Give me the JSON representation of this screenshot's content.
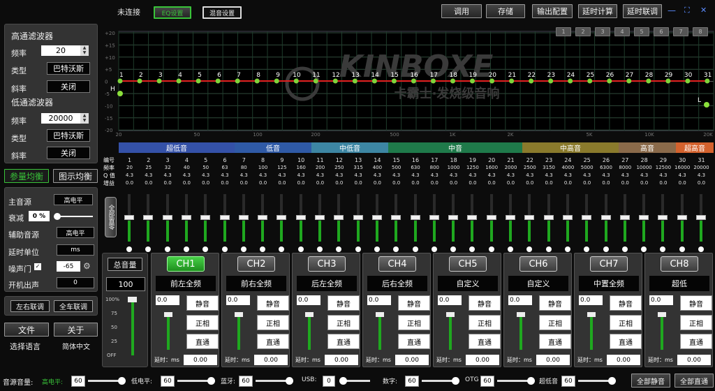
{
  "topbar": {
    "status": "未连接",
    "tab_eq": "EQ设置",
    "tab_mix": "混音设置",
    "buttons": [
      "调用",
      "存储",
      "输出配置",
      "延时计算",
      "延时联调"
    ],
    "win_min": "—",
    "win_max": "⛶",
    "win_close": "✕"
  },
  "presets": [
    "1",
    "2",
    "3",
    "4",
    "5",
    "6",
    "7",
    "8"
  ],
  "highpass": {
    "title": "高通滤波器",
    "freq_label": "频率",
    "freq": "20",
    "type_label": "类型",
    "type": "巴特沃斯",
    "slope_label": "斜率",
    "slope": "关闭"
  },
  "lowpass": {
    "title": "低通滤波器",
    "freq_label": "频率",
    "freq": "20000",
    "type_label": "类型",
    "type": "巴特沃斯",
    "slope_label": "斜率",
    "slope": "关闭"
  },
  "modes": {
    "param": "参量均衡",
    "graphic": "图示均衡"
  },
  "source": {
    "main_label": "主音源",
    "main": "高电平",
    "atten_label": "衰减",
    "atten": "0 %",
    "aux_label": "辅助音源",
    "aux": "高电平",
    "delay_unit_label": "延时单位",
    "delay_unit": "ms",
    "noise_label": "噪声门",
    "noise": "-65",
    "power_label": "开机出声",
    "power": "0"
  },
  "link": {
    "lr": "左右联调",
    "all": "全车联调"
  },
  "file": {
    "file": "文件",
    "about": "关于",
    "lang_label": "选择语言",
    "lang": "简体中文"
  },
  "graph": {
    "y_labels": [
      "+20",
      "+15",
      "+10",
      "+5",
      "0",
      "-5",
      "-10",
      "-15",
      "-20"
    ],
    "x_labels": [
      "20",
      "50",
      "100",
      "200",
      "500",
      "1K",
      "2K",
      "5K",
      "10K",
      "20K"
    ],
    "watermark": "KINBOXE",
    "watermark_sub": "卡霸士·发烧级音响",
    "h_marker": "H",
    "l_marker": "L"
  },
  "bands": [
    {
      "name": "超低音",
      "color": "#3451a8"
    },
    {
      "name": "低音",
      "color": "#2f5aa6"
    },
    {
      "name": "中低音",
      "color": "#3d86a3"
    },
    {
      "name": "中音",
      "color": "#1f7a4a"
    },
    {
      "name": "中高音",
      "color": "#8a7a2c"
    },
    {
      "name": "高音",
      "color": "#8a6a4a"
    },
    {
      "name": "超高音",
      "color": "#d4622d"
    }
  ],
  "eq_headers": {
    "num": "编号",
    "freq": "频率",
    "q": "Q 值",
    "gain": "增益"
  },
  "eq_freqs": [
    "20",
    "25",
    "32",
    "40",
    "50",
    "63",
    "80",
    "100",
    "125",
    "160",
    "200",
    "250",
    "315",
    "400",
    "500",
    "630",
    "800",
    "1000",
    "1250",
    "1600",
    "2000",
    "2500",
    "3150",
    "4000",
    "5000",
    "6300",
    "8000",
    "10000",
    "12500",
    "16000",
    "20000"
  ],
  "eq_q": "4.3",
  "eq_gain": "0.0",
  "reset_all": "全部置零",
  "master": {
    "label": "总音量",
    "value": "100",
    "scale": [
      "100%",
      "75",
      "50",
      "25",
      "OFF"
    ]
  },
  "channels": [
    {
      "id": "CH1",
      "name": "前左全频",
      "db": "0.0",
      "delay": "0.00"
    },
    {
      "id": "CH2",
      "name": "前右全频",
      "db": "0.0",
      "delay": "0.00"
    },
    {
      "id": "CH3",
      "name": "后左全频",
      "db": "0.0",
      "delay": "0.00"
    },
    {
      "id": "CH4",
      "name": "后右全频",
      "db": "0.0",
      "delay": "0.00"
    },
    {
      "id": "CH5",
      "name": "自定义",
      "db": "0.0",
      "delay": "0.00"
    },
    {
      "id": "CH6",
      "name": "自定义",
      "db": "0.0",
      "delay": "0.00"
    },
    {
      "id": "CH7",
      "name": "中置全频",
      "db": "0.0",
      "delay": "0.00"
    },
    {
      "id": "CH8",
      "name": "超低",
      "db": "0.0",
      "delay": "0.00"
    }
  ],
  "ch_labels": {
    "mute": "静音",
    "phase": "正相",
    "mode": "直通",
    "delay": "延时：ms"
  },
  "bottom": {
    "src_label": "音源音量:",
    "high_label": "高电平:",
    "high": "60",
    "low_label": "低电平:",
    "low": "60",
    "bt_label": "蓝牙:",
    "bt": "60",
    "usb_label": "USB:",
    "usb": "0",
    "dig_label": "数字:",
    "dig": "60",
    "otg_label": "OTG",
    "otg": "60",
    "sub_label": "超低音",
    "sub": "60",
    "mute_all": "全部静音",
    "pass_all": "全部直通"
  }
}
